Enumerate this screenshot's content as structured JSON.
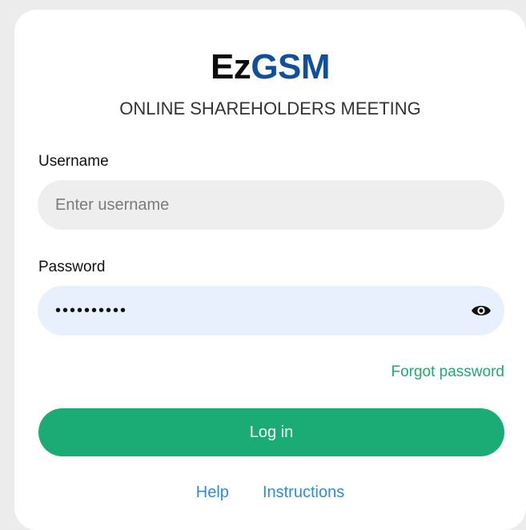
{
  "brand": {
    "logo_part1": "Ez",
    "logo_part2": "GSM",
    "subtitle": "ONLINE SHAREHOLDERS MEETING",
    "colors": {
      "ez": "#0d0d0d",
      "gsm": "#114f9a"
    }
  },
  "form": {
    "username": {
      "label": "Username",
      "value": "",
      "placeholder": "Enter username"
    },
    "password": {
      "label": "Password",
      "value": "••••••••••",
      "toggle_icon": "eye-icon"
    },
    "forgot_password": "Forgot password",
    "login_button": "Log in"
  },
  "footer": {
    "help": "Help",
    "instructions": "Instructions"
  },
  "colors": {
    "primary_green": "#1aac74",
    "link_green": "#22a773",
    "link_blue": "#2f8cd8",
    "username_field_bg": "#eeeeee",
    "password_field_bg": "#e8f0fe"
  }
}
